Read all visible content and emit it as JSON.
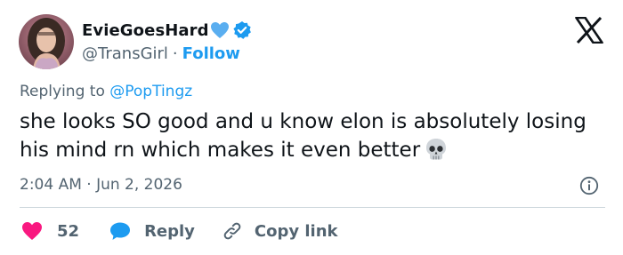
{
  "author": {
    "display_name": "EvieGoesHard",
    "name_emoji": "blue-heart-icon",
    "verified": true,
    "handle": "@TransGirl",
    "separator": "·",
    "follow_label": "Follow"
  },
  "tweet": {
    "replying_prefix": "Replying to",
    "replying_to": "@PopTingz",
    "text": "she looks SO good and u know elon is absolutely losing his mind rn which makes it even better",
    "trailing_emoji": "skull-icon",
    "timestamp": "2:04 AM · Jun 2, 2026"
  },
  "actions": {
    "like_count": "52",
    "reply_label": "Reply",
    "copy_label": "Copy link"
  },
  "colors": {
    "accent": "#1d9bf0",
    "like": "#f91880",
    "text": "#0f1419",
    "secondary": "#536471",
    "divider": "#cfd9de"
  }
}
